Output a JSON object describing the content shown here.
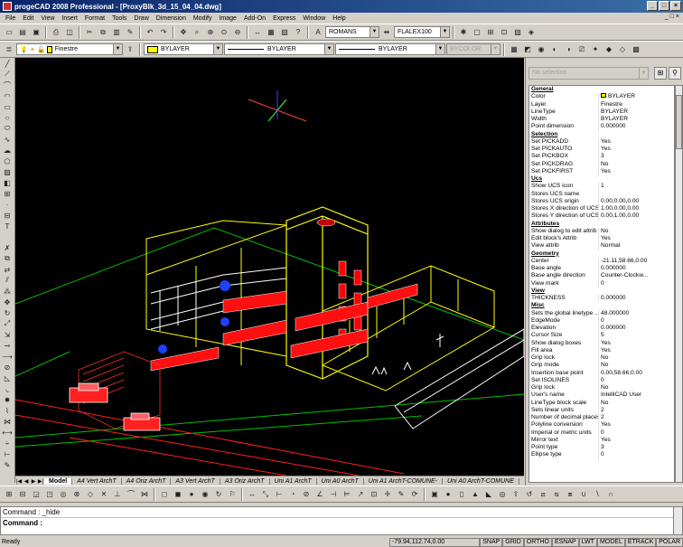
{
  "window": {
    "title": "progeCAD 2008 Professional - [ProxyBlk_3d_15_04_04.dwg]",
    "min": "_",
    "max": "□",
    "close": "×"
  },
  "menu": [
    "File",
    "Edit",
    "View",
    "Insert",
    "Format",
    "Tools",
    "Draw",
    "Dimension",
    "Modify",
    "Image",
    "Add-On",
    "Express",
    "Window",
    "Help"
  ],
  "mdi_controls": [
    "_",
    "□",
    "×"
  ],
  "toolbar1": {
    "textstyle": "ROMANS",
    "dimstyle": "FLALEX100"
  },
  "toolbar2": {
    "layer": "Finestre",
    "color": "BYLAYER",
    "linetype": "BYLAYER",
    "lineweight": "BYLAYER",
    "plotstyle": "BYCOLOR"
  },
  "accent_colors": {
    "canvas": "#000000",
    "title_bar": "#0a246a",
    "layer_color": "#ffff00"
  },
  "properties": {
    "selection": "No selection",
    "rows": [
      {
        "cat": "General"
      },
      {
        "k": "Color",
        "v": "BYLAYER",
        "swatch": true
      },
      {
        "k": "Layer",
        "v": "Finestre"
      },
      {
        "k": "LineType",
        "v": "BYLAYER"
      },
      {
        "k": "Width",
        "v": "BYLAYER"
      },
      {
        "k": "Point dimension",
        "v": "0.000000"
      },
      {
        "cat": "Selection"
      },
      {
        "k": "Set PICKADD",
        "v": "Yes"
      },
      {
        "k": "Set PICKAUTO",
        "v": "Yes"
      },
      {
        "k": "Set PICKBOX",
        "v": "3"
      },
      {
        "k": "Set PICKDRAG",
        "v": "No"
      },
      {
        "k": "Set PICKFIRST",
        "v": "Yes"
      },
      {
        "cat": "Ucs"
      },
      {
        "k": "Show UCS icon",
        "v": "1"
      },
      {
        "k": "Stores UCS name",
        "v": ""
      },
      {
        "k": "Stores UCS origin",
        "v": "0.00,0.00,0.00"
      },
      {
        "k": "Stores X direction of UCS",
        "v": "1.00,0.00,0.00"
      },
      {
        "k": "Stores Y direction of UCS",
        "v": "0.00,1.00,0.00"
      },
      {
        "cat": "Attributes"
      },
      {
        "k": "Show dialog to edit attrib",
        "v": "No"
      },
      {
        "k": "Edit block's Attrib",
        "v": "Yes"
      },
      {
        "k": "View attrib",
        "v": "Normal"
      },
      {
        "cat": "Geometry"
      },
      {
        "k": "Center",
        "v": "-21.11,58.66,0.00"
      },
      {
        "k": "Base angle",
        "v": "0.000000"
      },
      {
        "k": "Base angle direction",
        "v": "Counter-Clockw..."
      },
      {
        "k": "View mark",
        "v": "0"
      },
      {
        "cat": "View"
      },
      {
        "k": "THICKNESS",
        "v": "0.000000"
      },
      {
        "cat": "Misc"
      },
      {
        "k": "Sets the global linetype ...",
        "v": "48.000000"
      },
      {
        "k": "EdgeMode",
        "v": "0"
      },
      {
        "k": "Elevation",
        "v": "0.000000"
      },
      {
        "k": "Cursor Size",
        "v": "5"
      },
      {
        "k": "Show dialog boxes",
        "v": "Yes"
      },
      {
        "k": "Fill area",
        "v": "Yes"
      },
      {
        "k": "Grip lock",
        "v": "No"
      },
      {
        "k": "Grip mode",
        "v": "No"
      },
      {
        "k": "Insertion base point",
        "v": "0.00,58.66,0.00"
      },
      {
        "k": "Set ISOLINES",
        "v": "0"
      },
      {
        "k": "Grip lock",
        "v": "No"
      },
      {
        "k": "User's name",
        "v": "IntelliCAD User"
      },
      {
        "k": "LineType block scale",
        "v": "No"
      },
      {
        "k": "Sets linear units",
        "v": "2"
      },
      {
        "k": "Number of decimal places",
        "v": "2"
      },
      {
        "k": "Polyline conversion",
        "v": "Yes"
      },
      {
        "k": "Imperial or metric units",
        "v": "0"
      },
      {
        "k": "Mirror text",
        "v": "Yes"
      },
      {
        "k": "Point type",
        "v": "3"
      },
      {
        "k": "Ellipse type",
        "v": "0"
      }
    ]
  },
  "layout_tabs": [
    "Model",
    "A4 Vert ArchT",
    "A4 Oriz ArchT",
    "A3 Vert ArchT",
    "A3 Oriz ArchT",
    "Uni A1 ArchT",
    "Uni A0 ArchT",
    "Uni A1 ArchT-COMUNE-",
    "Uni A0 ArchT-COMUNE"
  ],
  "command": {
    "history": "Command : _hide",
    "prompt": "Command :"
  },
  "status": {
    "ready": "Ready",
    "coords": "-79.94,112.74,0.00",
    "buttons": [
      "SNAP",
      "GRID",
      "ORTHO",
      "ESNAP",
      "LWT",
      "MODEL",
      "ETRACK",
      "POLAR"
    ]
  }
}
